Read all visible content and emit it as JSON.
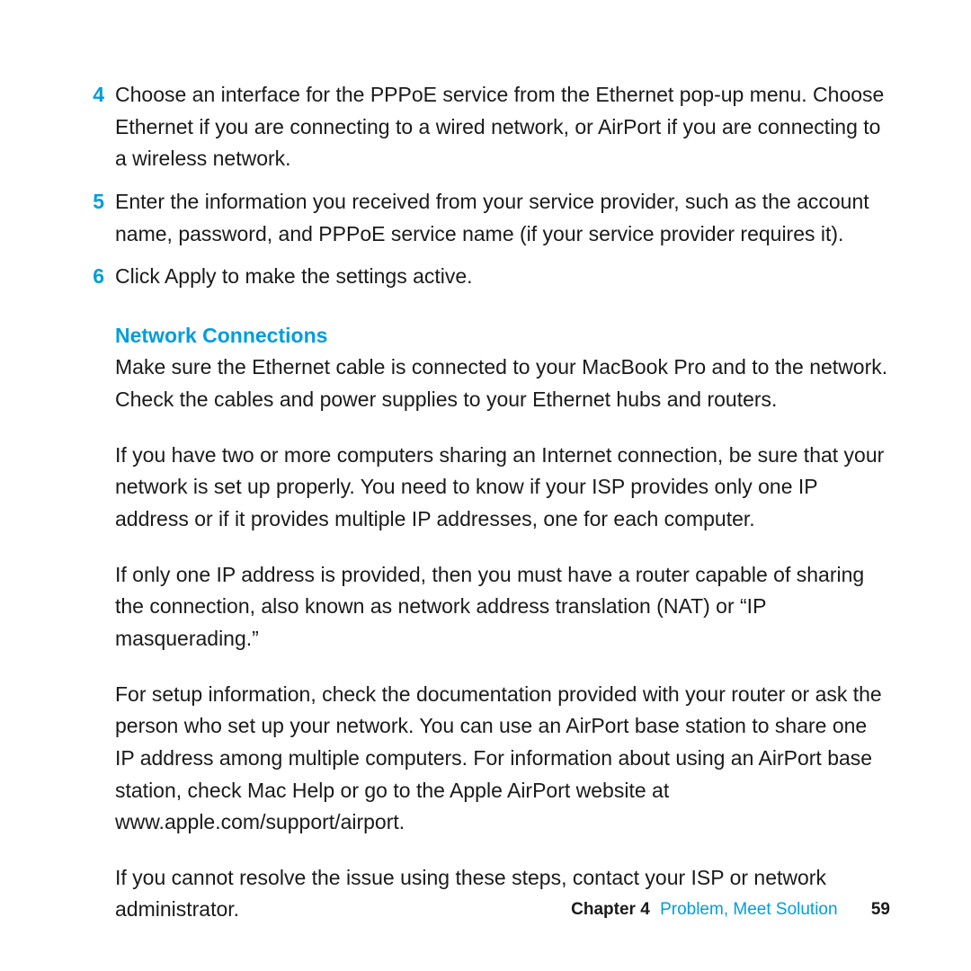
{
  "steps": [
    {
      "num": "4",
      "text": "Choose an interface for the PPPoE service from the Ethernet pop-up menu. Choose Ethernet if you are connecting to a wired network, or AirPort if you are connecting to a wireless network."
    },
    {
      "num": "5",
      "text": "Enter the information you received from your service provider, such as the account name, password, and PPPoE service name (if your service provider requires it)."
    },
    {
      "num": "6",
      "text": "Click Apply to make the settings active."
    }
  ],
  "subheading": "Network Connections",
  "paragraphs": [
    "Make sure the Ethernet cable is connected to your MacBook Pro and to the network. Check the cables and power supplies to your Ethernet hubs and routers.",
    "If you have two or more computers sharing an Internet connection, be sure that your network is set up properly. You need to know if your ISP provides only one IP address or if it provides multiple IP addresses, one for each computer.",
    "If only one IP address is provided, then you must have a router capable of sharing the connection, also known as network address translation (NAT) or “IP masquerading.”",
    "For setup information, check the documentation provided with your router or ask the person who set up your network. You can use an AirPort base station to share one IP address among multiple computers. For information about using an AirPort base station, check Mac Help or go to the Apple AirPort website at www.apple.com/support/airport.",
    "If you cannot resolve the issue using these steps, contact your ISP or network administrator."
  ],
  "footer": {
    "chapter_label": "Chapter 4",
    "chapter_title": "Problem, Meet Solution",
    "page_number": "59"
  }
}
